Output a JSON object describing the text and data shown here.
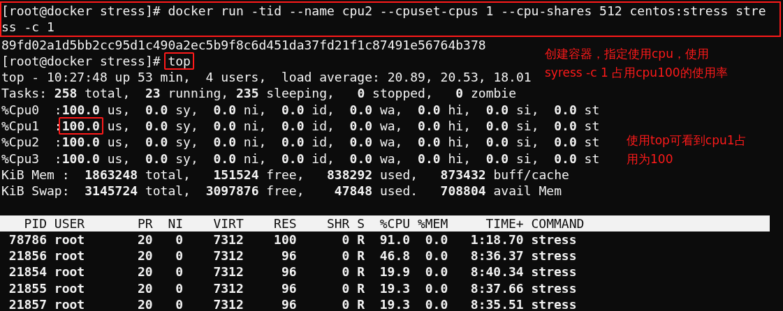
{
  "terminal": {
    "blocks": [
      {
        "highlighted": true,
        "lines": [
          {
            "segments": [
              {
                "text": "[root@docker stress]# docker run -tid --name cpu2 --cpuset-cpus 1 --cpu-shares 512 centos:stress stre",
                "highlighted": false
              }
            ]
          },
          {
            "segments": [
              {
                "text": "ss -c 1",
                "highlighted": false
              }
            ]
          }
        ]
      },
      {
        "highlighted": false,
        "lines": [
          {
            "segments": [
              {
                "text": "89fd02a1d5bb2cc95d1c490a2ec5b9f8c6d451da37fd21f1c87491e56764b378",
                "highlighted": false
              }
            ]
          },
          {
            "segments": [
              {
                "text": "[root@docker stress]# ",
                "highlighted": false
              },
              {
                "text": "top",
                "highlighted": true
              }
            ]
          },
          {
            "segments": [
              {
                "text": "top - 10:27:48 up 53 min,  4 users,  load average: 20.89, 20.53, 18.01",
                "highlighted": false
              }
            ]
          },
          {
            "segments": [
              {
                "text": "Tasks: **258** total,  **23** running, **235** sleeping,   **0** stopped,   **0** zombie",
                "highlighted": false
              }
            ]
          },
          {
            "segments": [
              {
                "text": "%Cpu0  :**100.0** us,  **0.0** sy,  **0.0** ni,  **0.0** id,  **0.0** wa,  **0.0** hi,  **0.0** si,  **0.0** st",
                "highlighted": false
              }
            ]
          },
          {
            "segments": [
              {
                "text": "%Cpu1  :",
                "highlighted": false
              },
              {
                "text": "**100.0**",
                "highlighted": true
              },
              {
                "text": " us,  **0.0** sy,  **0.0** ni,  **0.0** id,  **0.0** wa,  **0.0** hi,  **0.0** si,  **0.0** st",
                "highlighted": false
              }
            ]
          },
          {
            "segments": [
              {
                "text": "%Cpu2  :**100.0** us,  **0.0** sy,  **0.0** ni,  **0.0** id,  **0.0** wa,  **0.0** hi,  **0.0** si,  **0.0** st",
                "highlighted": false
              }
            ]
          },
          {
            "segments": [
              {
                "text": "%Cpu3  :**100.0** us,  **0.0** sy,  **0.0** ni,  **0.0** id,  **0.0** wa,  **0.0** hi,  **0.0** si,  **0.0** st",
                "highlighted": false
              }
            ]
          },
          {
            "segments": [
              {
                "text": "KiB Mem :  **1863248** total,   **151524** free,   **838292** used,   **873432** buff/cache",
                "highlighted": false
              }
            ]
          },
          {
            "segments": [
              {
                "text": "KiB Swap:  **3145724** total,  **3097876** free,    **47848** used.   **708804** avail Mem",
                "highlighted": false
              }
            ]
          }
        ]
      }
    ]
  },
  "process_table": {
    "columns": [
      "PID",
      "USER",
      "PR",
      "NI",
      "VIRT",
      "RES",
      "SHR",
      "S",
      "%CPU",
      "%MEM",
      "TIME+",
      "COMMAND"
    ],
    "rows": [
      [
        "78786",
        "root",
        "20",
        "0",
        "7312",
        "100",
        "0",
        "R",
        "91.0",
        "0.0",
        "1:18.70",
        "stress"
      ],
      [
        "21856",
        "root",
        "20",
        "0",
        "7312",
        "96",
        "0",
        "R",
        "46.8",
        "0.0",
        "8:36.37",
        "stress"
      ],
      [
        "21854",
        "root",
        "20",
        "0",
        "7312",
        "96",
        "0",
        "R",
        "19.9",
        "0.0",
        "8:40.34",
        "stress"
      ],
      [
        "21855",
        "root",
        "20",
        "0",
        "7312",
        "96",
        "0",
        "R",
        "19.3",
        "0.0",
        "8:37.66",
        "stress"
      ],
      [
        "21857",
        "root",
        "20",
        "0",
        "7312",
        "96",
        "0",
        "R",
        "19.3",
        "0.0",
        "8:35.51",
        "stress"
      ]
    ]
  },
  "annotations": [
    {
      "lines": [
        "创建容器，指定使用cpu，使用",
        "syress -c 1 占用cpu100的使用率"
      ]
    },
    {
      "lines": [
        "使用top可看到cpu1占",
        "用为100"
      ]
    }
  ]
}
